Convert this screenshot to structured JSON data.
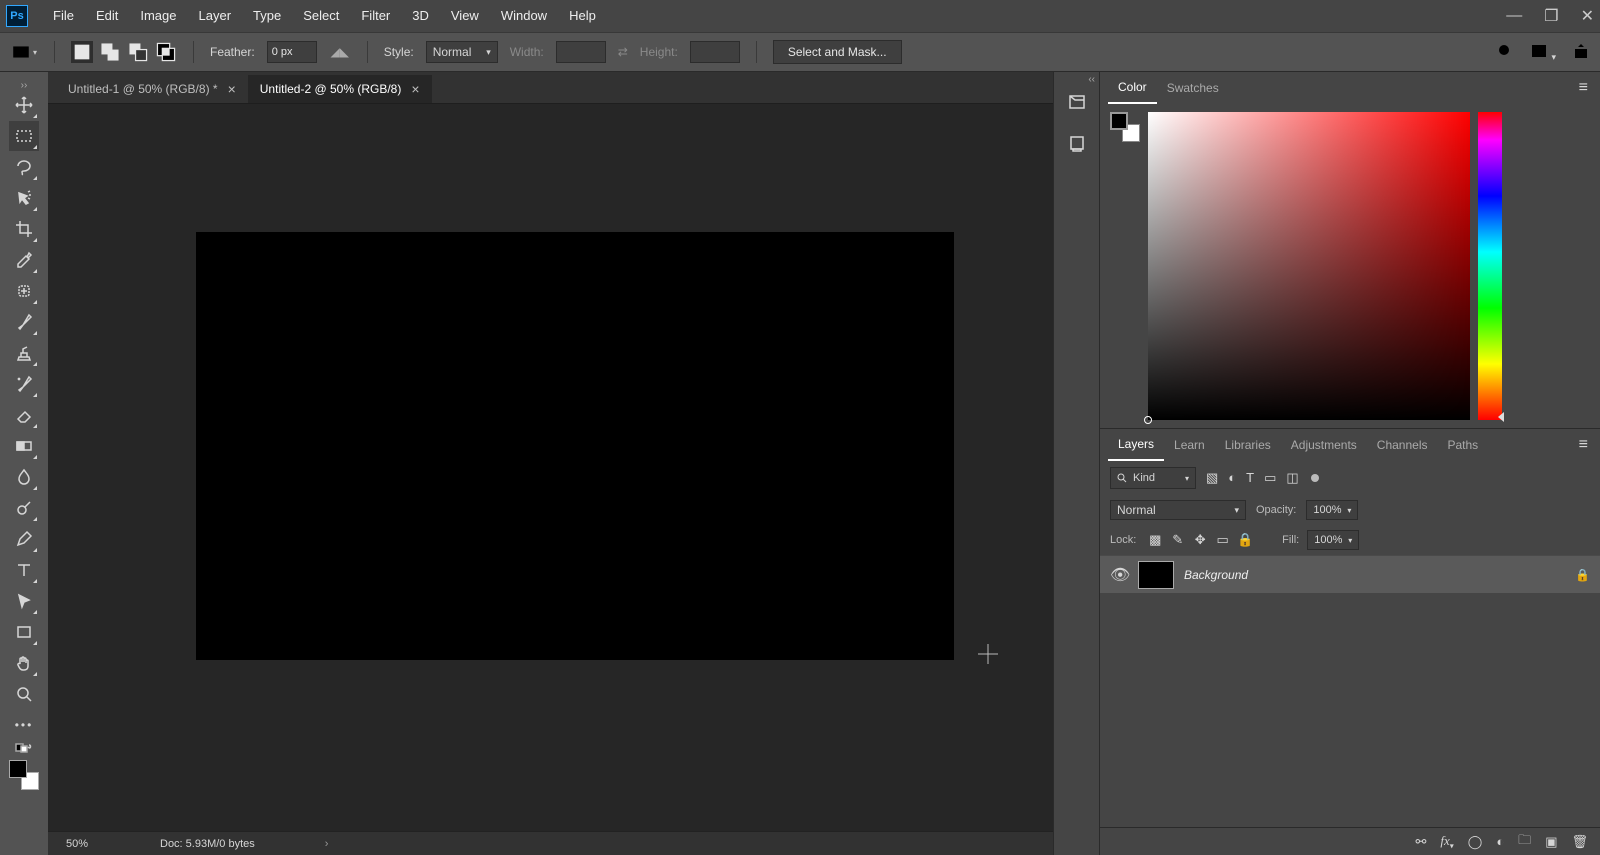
{
  "app_logo_text": "Ps",
  "menu": [
    "File",
    "Edit",
    "Image",
    "Layer",
    "Type",
    "Select",
    "Filter",
    "3D",
    "View",
    "Window",
    "Help"
  ],
  "window_controls": {
    "min": "—",
    "max": "❐",
    "close": "✕"
  },
  "options_bar": {
    "feather_label": "Feather:",
    "feather_value": "0 px",
    "antialias_icon": "anti-alias",
    "style_label": "Style:",
    "style_value": "Normal",
    "width_label": "Width:",
    "width_value": "",
    "swap_icon": "⇄",
    "height_label": "Height:",
    "height_value": "",
    "select_mask_btn": "Select and Mask..."
  },
  "tabs": [
    {
      "title": "Untitled-1 @ 50% (RGB/8) *",
      "active": false
    },
    {
      "title": "Untitled-2 @ 50% (RGB/8)",
      "active": true
    }
  ],
  "statusbar": {
    "zoom": "50%",
    "doc": "Doc: 5.93M/0 bytes"
  },
  "collapsed_panels": [
    "history",
    "libraries"
  ],
  "color_panel": {
    "tabs": [
      "Color",
      "Swatches"
    ],
    "active": "Color"
  },
  "layers_panel": {
    "tabs": [
      "Layers",
      "Learn",
      "Libraries",
      "Adjustments",
      "Channels",
      "Paths"
    ],
    "active": "Layers",
    "filter_kind": "Kind",
    "blend_mode": "Normal",
    "opacity_label": "Opacity:",
    "opacity_value": "100%",
    "lock_label": "Lock:",
    "fill_label": "Fill:",
    "fill_value": "100%",
    "layers": [
      {
        "name": "Background",
        "locked": true,
        "thumb": "#000000"
      }
    ]
  },
  "tools": [
    "move",
    "rect-marquee",
    "lasso",
    "quick-select",
    "crop",
    "eyedropper",
    "healing-brush",
    "brush",
    "clone",
    "history-brush",
    "eraser",
    "gradient",
    "blur",
    "dodge",
    "pen",
    "type",
    "path-select",
    "rect-shape",
    "hand",
    "zoom"
  ]
}
